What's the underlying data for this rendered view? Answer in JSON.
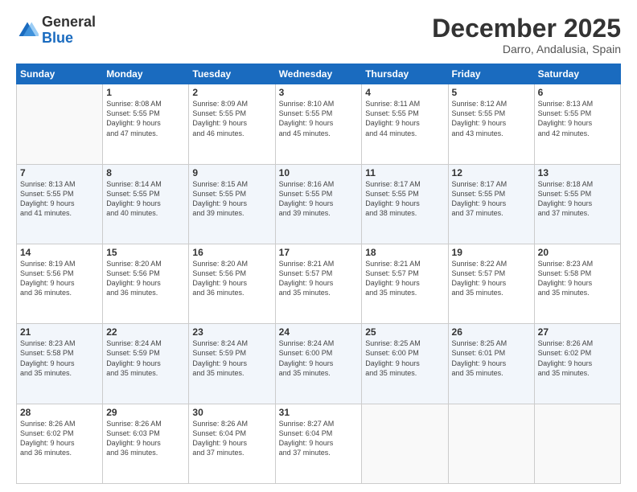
{
  "header": {
    "logo_general": "General",
    "logo_blue": "Blue",
    "month_title": "December 2025",
    "location": "Darro, Andalusia, Spain"
  },
  "weekdays": [
    "Sunday",
    "Monday",
    "Tuesday",
    "Wednesday",
    "Thursday",
    "Friday",
    "Saturday"
  ],
  "weeks": [
    [
      {
        "day": "",
        "info": ""
      },
      {
        "day": "1",
        "info": "Sunrise: 8:08 AM\nSunset: 5:55 PM\nDaylight: 9 hours\nand 47 minutes."
      },
      {
        "day": "2",
        "info": "Sunrise: 8:09 AM\nSunset: 5:55 PM\nDaylight: 9 hours\nand 46 minutes."
      },
      {
        "day": "3",
        "info": "Sunrise: 8:10 AM\nSunset: 5:55 PM\nDaylight: 9 hours\nand 45 minutes."
      },
      {
        "day": "4",
        "info": "Sunrise: 8:11 AM\nSunset: 5:55 PM\nDaylight: 9 hours\nand 44 minutes."
      },
      {
        "day": "5",
        "info": "Sunrise: 8:12 AM\nSunset: 5:55 PM\nDaylight: 9 hours\nand 43 minutes."
      },
      {
        "day": "6",
        "info": "Sunrise: 8:13 AM\nSunset: 5:55 PM\nDaylight: 9 hours\nand 42 minutes."
      }
    ],
    [
      {
        "day": "7",
        "info": "Sunrise: 8:13 AM\nSunset: 5:55 PM\nDaylight: 9 hours\nand 41 minutes."
      },
      {
        "day": "8",
        "info": "Sunrise: 8:14 AM\nSunset: 5:55 PM\nDaylight: 9 hours\nand 40 minutes."
      },
      {
        "day": "9",
        "info": "Sunrise: 8:15 AM\nSunset: 5:55 PM\nDaylight: 9 hours\nand 39 minutes."
      },
      {
        "day": "10",
        "info": "Sunrise: 8:16 AM\nSunset: 5:55 PM\nDaylight: 9 hours\nand 39 minutes."
      },
      {
        "day": "11",
        "info": "Sunrise: 8:17 AM\nSunset: 5:55 PM\nDaylight: 9 hours\nand 38 minutes."
      },
      {
        "day": "12",
        "info": "Sunrise: 8:17 AM\nSunset: 5:55 PM\nDaylight: 9 hours\nand 37 minutes."
      },
      {
        "day": "13",
        "info": "Sunrise: 8:18 AM\nSunset: 5:55 PM\nDaylight: 9 hours\nand 37 minutes."
      }
    ],
    [
      {
        "day": "14",
        "info": "Sunrise: 8:19 AM\nSunset: 5:56 PM\nDaylight: 9 hours\nand 36 minutes."
      },
      {
        "day": "15",
        "info": "Sunrise: 8:20 AM\nSunset: 5:56 PM\nDaylight: 9 hours\nand 36 minutes."
      },
      {
        "day": "16",
        "info": "Sunrise: 8:20 AM\nSunset: 5:56 PM\nDaylight: 9 hours\nand 36 minutes."
      },
      {
        "day": "17",
        "info": "Sunrise: 8:21 AM\nSunset: 5:57 PM\nDaylight: 9 hours\nand 35 minutes."
      },
      {
        "day": "18",
        "info": "Sunrise: 8:21 AM\nSunset: 5:57 PM\nDaylight: 9 hours\nand 35 minutes."
      },
      {
        "day": "19",
        "info": "Sunrise: 8:22 AM\nSunset: 5:57 PM\nDaylight: 9 hours\nand 35 minutes."
      },
      {
        "day": "20",
        "info": "Sunrise: 8:23 AM\nSunset: 5:58 PM\nDaylight: 9 hours\nand 35 minutes."
      }
    ],
    [
      {
        "day": "21",
        "info": "Sunrise: 8:23 AM\nSunset: 5:58 PM\nDaylight: 9 hours\nand 35 minutes."
      },
      {
        "day": "22",
        "info": "Sunrise: 8:24 AM\nSunset: 5:59 PM\nDaylight: 9 hours\nand 35 minutes."
      },
      {
        "day": "23",
        "info": "Sunrise: 8:24 AM\nSunset: 5:59 PM\nDaylight: 9 hours\nand 35 minutes."
      },
      {
        "day": "24",
        "info": "Sunrise: 8:24 AM\nSunset: 6:00 PM\nDaylight: 9 hours\nand 35 minutes."
      },
      {
        "day": "25",
        "info": "Sunrise: 8:25 AM\nSunset: 6:00 PM\nDaylight: 9 hours\nand 35 minutes."
      },
      {
        "day": "26",
        "info": "Sunrise: 8:25 AM\nSunset: 6:01 PM\nDaylight: 9 hours\nand 35 minutes."
      },
      {
        "day": "27",
        "info": "Sunrise: 8:26 AM\nSunset: 6:02 PM\nDaylight: 9 hours\nand 35 minutes."
      }
    ],
    [
      {
        "day": "28",
        "info": "Sunrise: 8:26 AM\nSunset: 6:02 PM\nDaylight: 9 hours\nand 36 minutes."
      },
      {
        "day": "29",
        "info": "Sunrise: 8:26 AM\nSunset: 6:03 PM\nDaylight: 9 hours\nand 36 minutes."
      },
      {
        "day": "30",
        "info": "Sunrise: 8:26 AM\nSunset: 6:04 PM\nDaylight: 9 hours\nand 37 minutes."
      },
      {
        "day": "31",
        "info": "Sunrise: 8:27 AM\nSunset: 6:04 PM\nDaylight: 9 hours\nand 37 minutes."
      },
      {
        "day": "",
        "info": ""
      },
      {
        "day": "",
        "info": ""
      },
      {
        "day": "",
        "info": ""
      }
    ]
  ]
}
